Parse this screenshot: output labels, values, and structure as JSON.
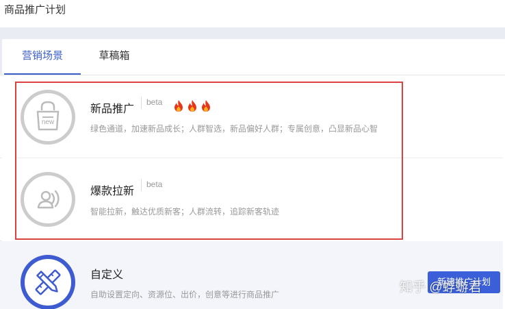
{
  "header": {
    "title": "商品推广计划"
  },
  "tabs": [
    {
      "label": "营销场景",
      "active": true
    },
    {
      "label": "草稿箱",
      "active": false
    }
  ],
  "scenes": [
    {
      "title": "新品推广",
      "badge": "beta",
      "icon": "new-shopping-bag-icon",
      "icon_text": "new",
      "flames": 3,
      "desc": "绿色通道，加速新品成长；人群智选，新品偏好人群；专属创意，凸显新品心智"
    },
    {
      "title": "爆款拉新",
      "badge": "beta",
      "icon": "user-signal-icon",
      "desc": "智能拉新，触达优质新客；人群流转，追踪新客轨迹"
    },
    {
      "title": "自定义",
      "icon": "pencil-ruler-icon",
      "desc": "自助设置定向、资源位、出价，创意等进行商品推广"
    }
  ],
  "create_button": {
    "label": "新建推广计划"
  },
  "watermark": "知乎 @蜉蝣君",
  "colors": {
    "accent": "#3a5fc6",
    "highlight": "#d9423f",
    "flame": "#e8361a"
  }
}
